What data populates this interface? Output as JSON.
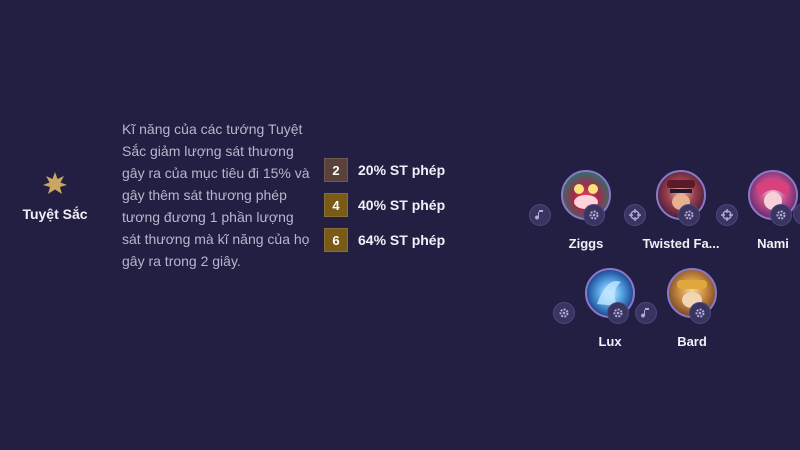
{
  "trait": {
    "name": "Tuyệt Sắc",
    "description": "Kĩ năng của các tướng Tuyệt Sắc giảm lượng sát thương gây ra của mục tiêu đi 15% và gây thêm sát thương phép tương đương 1 phần lượng sát thương mà kĩ năng của họ gây ra trong 2 giây.",
    "icon": "star-burst-icon",
    "icon_color": "#c9a661"
  },
  "tiers": [
    {
      "count": "2",
      "effect": "20% ST phép",
      "color": "#5b4238"
    },
    {
      "count": "4",
      "effect": "40% ST phép",
      "color": "#7a5a17"
    },
    {
      "count": "6",
      "effect": "64% ST phép",
      "color": "#7a5a17"
    }
  ],
  "champions": [
    {
      "name": "Ziggs",
      "left_icon": "music-note-icon",
      "right_icon": "gear-icon"
    },
    {
      "name": "Twisted Fa...",
      "left_icon": "crosshair-icon",
      "right_icon": "gear-icon"
    },
    {
      "name": "Nami",
      "left_icon": "crosshair-icon",
      "right_icon": "gear-icon"
    },
    {
      "name": "Lux",
      "left_icon": "gear-icon",
      "right_icon": "gear-icon"
    },
    {
      "name": "Bard",
      "left_icon": "music-note-icon",
      "right_icon": "gear-icon"
    }
  ]
}
